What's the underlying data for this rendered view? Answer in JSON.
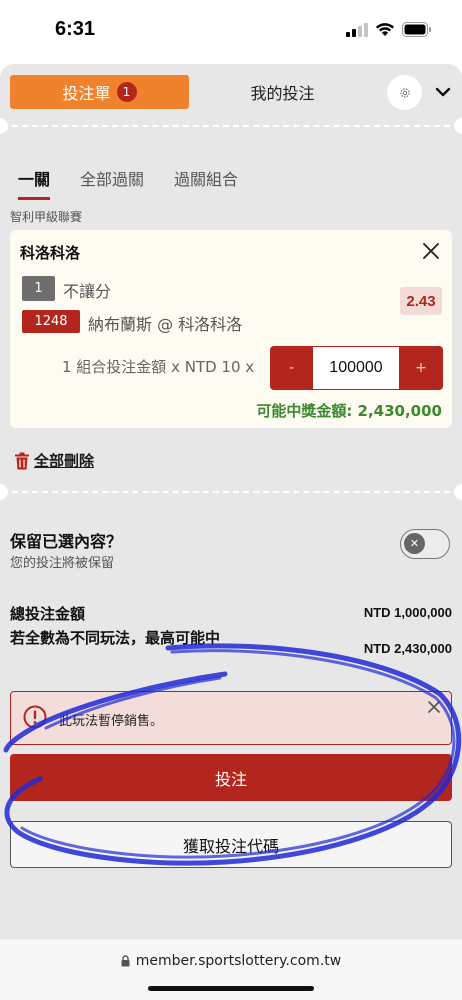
{
  "status_bar": {
    "time": "6:31"
  },
  "header": {
    "tab_betslip": "投注單",
    "betslip_count": "1",
    "tab_mybets": "我的投注",
    "settings_icon": "gear-icon",
    "collapse_icon": "chevron-down-icon"
  },
  "bet_types": [
    {
      "label": "一關",
      "active": true
    },
    {
      "label": "全部過關",
      "active": false
    },
    {
      "label": "過關組合",
      "active": false
    }
  ],
  "league": "智利甲級聯賽",
  "selection": {
    "team": "科洛科洛",
    "market_code": "1",
    "market_name": "不讓分",
    "game_code": "1248",
    "match": "納布蘭斯 @ 科洛科洛",
    "odds": "2.43",
    "stake_label": "1 組合投注金額 x NTD 10 x",
    "stake_minus": "-",
    "stake_value": "100000",
    "stake_plus": "+",
    "potential_payout": "可能中獎金額: 2,430,000"
  },
  "delete_all": "全部刪除",
  "keep_selections": {
    "title": "保留已選內容？",
    "subtitle": "您的投注將被保留",
    "toggle_on": false
  },
  "totals": {
    "total_label": "總投注金額",
    "total_value": "NTD 1,000,000",
    "max_label": "若全數為不同玩法，最高可能中",
    "max_value": "NTD 2,430,000"
  },
  "alert": {
    "message": "此玩法暫停銷售。"
  },
  "buttons": {
    "place_bet": "投注",
    "get_code": "獲取投注代碼"
  },
  "browser": {
    "url": "member.sportslottery.com.tw"
  },
  "colors": {
    "accent_orange": "#f0822e",
    "brand_red": "#b3261e",
    "payout_green": "#3c8a2e",
    "annotation_blue": "#2029d6"
  }
}
